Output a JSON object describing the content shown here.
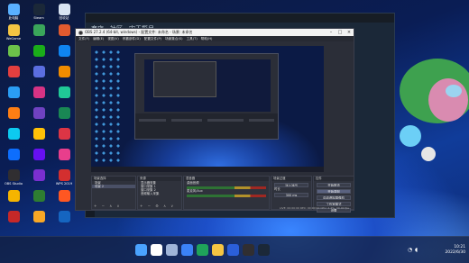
{
  "desktop": {
    "icons": [
      {
        "label": "此电脑",
        "color": "#59b0ff"
      },
      {
        "label": "Steam",
        "color": "#1b2838"
      },
      {
        "label": "回收站",
        "color": "#d9e4f2"
      },
      {
        "label": "WeGame",
        "color": "#f4c542"
      },
      {
        "label": "",
        "color": "#3aa65a"
      },
      {
        "label": "",
        "color": "#e05a2f"
      },
      {
        "label": "",
        "color": "#6cc24a"
      },
      {
        "label": "",
        "color": "#1aad19"
      },
      {
        "label": "",
        "color": "#0f84f1"
      },
      {
        "label": "",
        "color": "#e33f3f"
      },
      {
        "label": "",
        "color": "#5b6ee1"
      },
      {
        "label": "",
        "color": "#f08c00"
      },
      {
        "label": "",
        "color": "#2a9df4"
      },
      {
        "label": "",
        "color": "#d63384"
      },
      {
        "label": "",
        "color": "#20c997"
      },
      {
        "label": "",
        "color": "#fd7e14"
      },
      {
        "label": "",
        "color": "#6f42c1"
      },
      {
        "label": "",
        "color": "#198754"
      },
      {
        "label": "",
        "color": "#0dcaf0"
      },
      {
        "label": "",
        "color": "#ffc107"
      },
      {
        "label": "",
        "color": "#dc3545"
      },
      {
        "label": "",
        "color": "#0d6efd"
      },
      {
        "label": "",
        "color": "#6610f2"
      },
      {
        "label": "",
        "color": "#e83e8c"
      },
      {
        "label": "OBS Studio",
        "color": "#302e31"
      },
      {
        "label": "",
        "color": "#7a2fd0"
      },
      {
        "label": "WPS 2019",
        "color": "#d32f2f"
      },
      {
        "label": "",
        "color": "#f5b400"
      },
      {
        "label": "",
        "color": "#2e7d32"
      },
      {
        "label": "",
        "color": "#ff5722"
      },
      {
        "label": "",
        "color": "#c62828"
      },
      {
        "label": "",
        "color": "#f9a825"
      },
      {
        "label": "",
        "color": "#1565c0"
      }
    ]
  },
  "steam": {
    "nav": [
      "商店",
      "社区",
      "宋天揽月"
    ]
  },
  "obs": {
    "title": "OBS 27.2.4 (64-bit, windows) - 配置文件: 未命名 - 场景: 未命名",
    "menu": [
      "文件(F)",
      "编辑(E)",
      "视图(V)",
      "停靠部件(D)",
      "配置文件(P)",
      "场景集合(S)",
      "工具(T)",
      "帮助(H)"
    ],
    "docks": {
      "scenes": {
        "header": "场景选择",
        "items": [
          "场景",
          "场景 2"
        ],
        "selected": 1
      },
      "sources": {
        "header": "来源",
        "items": [
          "显示器采集",
          "窗口采集 1",
          "窗口采集 2",
          "音频输入采集"
        ]
      },
      "mixer": {
        "header": "混音器",
        "tracks": [
          "桌面音频",
          "麦克风/Aux"
        ]
      },
      "transitions": {
        "header": "场景过渡",
        "type": "淡入淡出",
        "duration_label": "时长",
        "duration": "300 ms"
      },
      "controls": {
        "header": "控件",
        "buttons": [
          "开始推流",
          "开始录制",
          "启动虚拟摄像机",
          "工作室模式",
          "设置",
          "退出"
        ],
        "highlighted": 1
      }
    },
    "status": "LIVE: 00:00:00   REC: 00:00:00   CPU: 2.4%, 30.00 fps"
  },
  "taskbar": {
    "apps": [
      {
        "name": "start-icon",
        "color": "#4aa3ff"
      },
      {
        "name": "search-icon",
        "color": "#ffffff"
      },
      {
        "name": "taskview-icon",
        "color": "#9fb4d8"
      },
      {
        "name": "widgets-icon",
        "color": "#3b82f6"
      },
      {
        "name": "edge-icon",
        "color": "#1fa35a"
      },
      {
        "name": "explorer-icon",
        "color": "#f5c542"
      },
      {
        "name": "store-icon",
        "color": "#2b5fd9"
      },
      {
        "name": "obs-icon",
        "color": "#302e31"
      },
      {
        "name": "steam-icon",
        "color": "#1b2838"
      }
    ],
    "time": "10:21",
    "date": "2022/6/30"
  }
}
